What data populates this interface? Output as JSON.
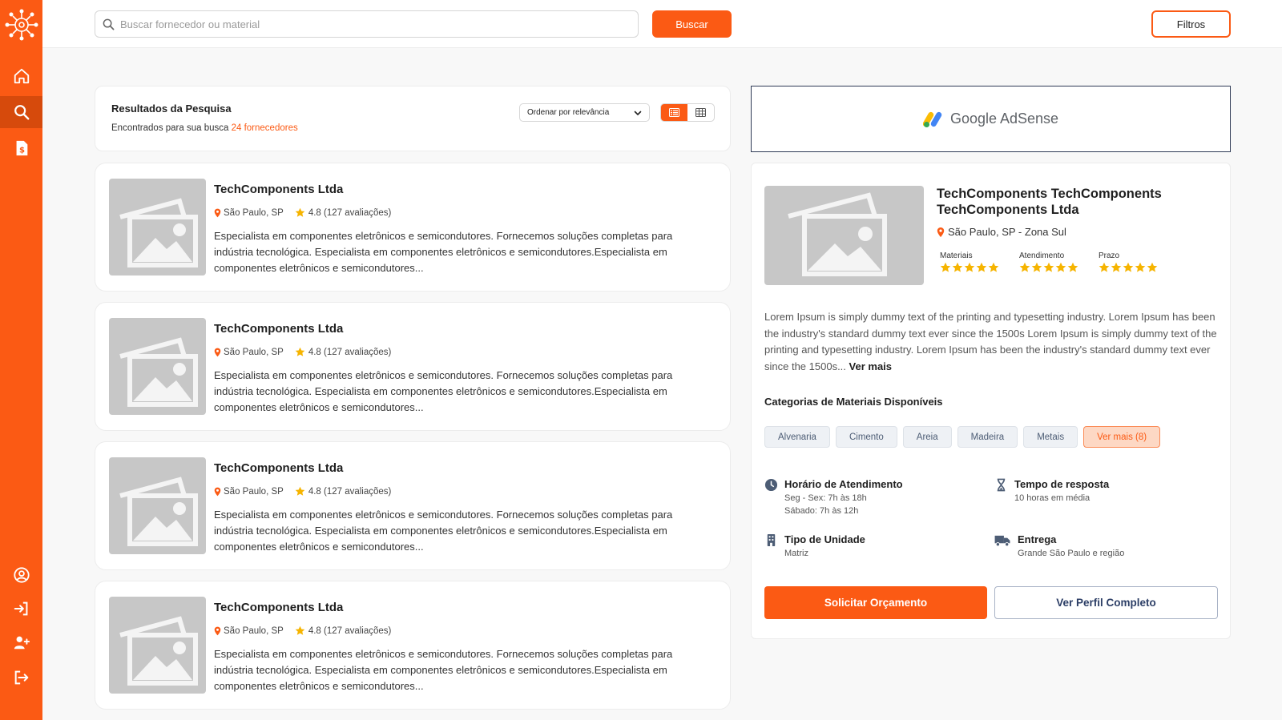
{
  "colors": {
    "accent": "#fb5a14",
    "star": "#f6b400",
    "sidebar": "#fb5a14"
  },
  "sidebar": {
    "items": [
      {
        "name": "home",
        "icon": "home-icon"
      },
      {
        "name": "search",
        "icon": "search-icon",
        "active": true
      },
      {
        "name": "documents",
        "icon": "document-icon"
      },
      {
        "name": "account",
        "icon": "user-circle-icon"
      },
      {
        "name": "login",
        "icon": "login-icon"
      },
      {
        "name": "add-user",
        "icon": "user-plus-icon"
      },
      {
        "name": "logout",
        "icon": "logout-icon"
      }
    ]
  },
  "search": {
    "placeholder": "Buscar fornecedor ou material",
    "value": "",
    "button_label": "Buscar"
  },
  "filters_label": "Filtros",
  "results": {
    "title": "Resultados da Pesquisa",
    "subtitle_prefix": "Encontrados para sua busca",
    "count_text": "24 fornecedores",
    "sort_label": "Ordenar por relevância",
    "view_mode": "list"
  },
  "cards": [
    {
      "name": "TechComponents Ltda",
      "location": "São Paulo, SP",
      "rating": "4.8 (127 avaliações)",
      "description": "Especialista em componentes eletrônicos e semicondutores. Fornecemos soluções completas para indústria tecnológica. Especialista em componentes eletrônicos e semicondutores.Especialista em componentes eletrônicos e semicondutores..."
    },
    {
      "name": "TechComponents Ltda",
      "location": "São Paulo, SP",
      "rating": "4.8 (127 avaliações)",
      "description": "Especialista em componentes eletrônicos e semicondutores. Fornecemos soluções completas para indústria tecnológica. Especialista em componentes eletrônicos e semicondutores.Especialista em componentes eletrônicos e semicondutores..."
    },
    {
      "name": "TechComponents Ltda",
      "location": "São Paulo, SP",
      "rating": "4.8 (127 avaliações)",
      "description": "Especialista em componentes eletrônicos e semicondutores. Fornecemos soluções completas para indústria tecnológica. Especialista em componentes eletrônicos e semicondutores.Especialista em componentes eletrônicos e semicondutores..."
    },
    {
      "name": "TechComponents Ltda",
      "location": "São Paulo, SP",
      "rating": "4.8 (127 avaliações)",
      "description": "Especialista em componentes eletrônicos e semicondutores. Fornecemos soluções completas para indústria tecnológica. Especialista em componentes eletrônicos e semicondutores.Especialista em componentes eletrônicos e semicondutores..."
    }
  ],
  "ad": {
    "text": "Google AdSense"
  },
  "detail": {
    "name": "TechComponents TechComponents TechComponents Ltda",
    "location": "São Paulo, SP - Zona Sul",
    "ratings": [
      {
        "label": "Materiais",
        "stars": 5
      },
      {
        "label": "Atendimento",
        "stars": 5
      },
      {
        "label": "Prazo",
        "stars": 5
      }
    ],
    "description": "Lorem Ipsum is simply dummy text of the printing and typesetting industry. Lorem Ipsum has been the industry's standard dummy text ever since the 1500s Lorem Ipsum is simply dummy text of the printing and typesetting industry. Lorem Ipsum has been the industry's standard dummy text ever since the 1500s...",
    "see_more": "Ver mais",
    "categories_title": "Categorias de Materiais Disponíveis",
    "categories": [
      "Alvenaria",
      "Cimento",
      "Areia",
      "Madeira",
      "Metais"
    ],
    "categories_more": "Ver mais (8)",
    "hours": {
      "title": "Horário de Atendimento",
      "line1": "Seg - Sex: 7h às 18h",
      "line2": "Sábado: 7h às 12h"
    },
    "response": {
      "title": "Tempo de resposta",
      "line1": "10 horas em média"
    },
    "unit": {
      "title": "Tipo de Unidade",
      "line1": "Matriz"
    },
    "delivery": {
      "title": "Entrega",
      "line1": "Grande São Paulo e região"
    },
    "quote_button": "Solicitar Orçamento",
    "profile_button": "Ver Perfil Completo"
  }
}
